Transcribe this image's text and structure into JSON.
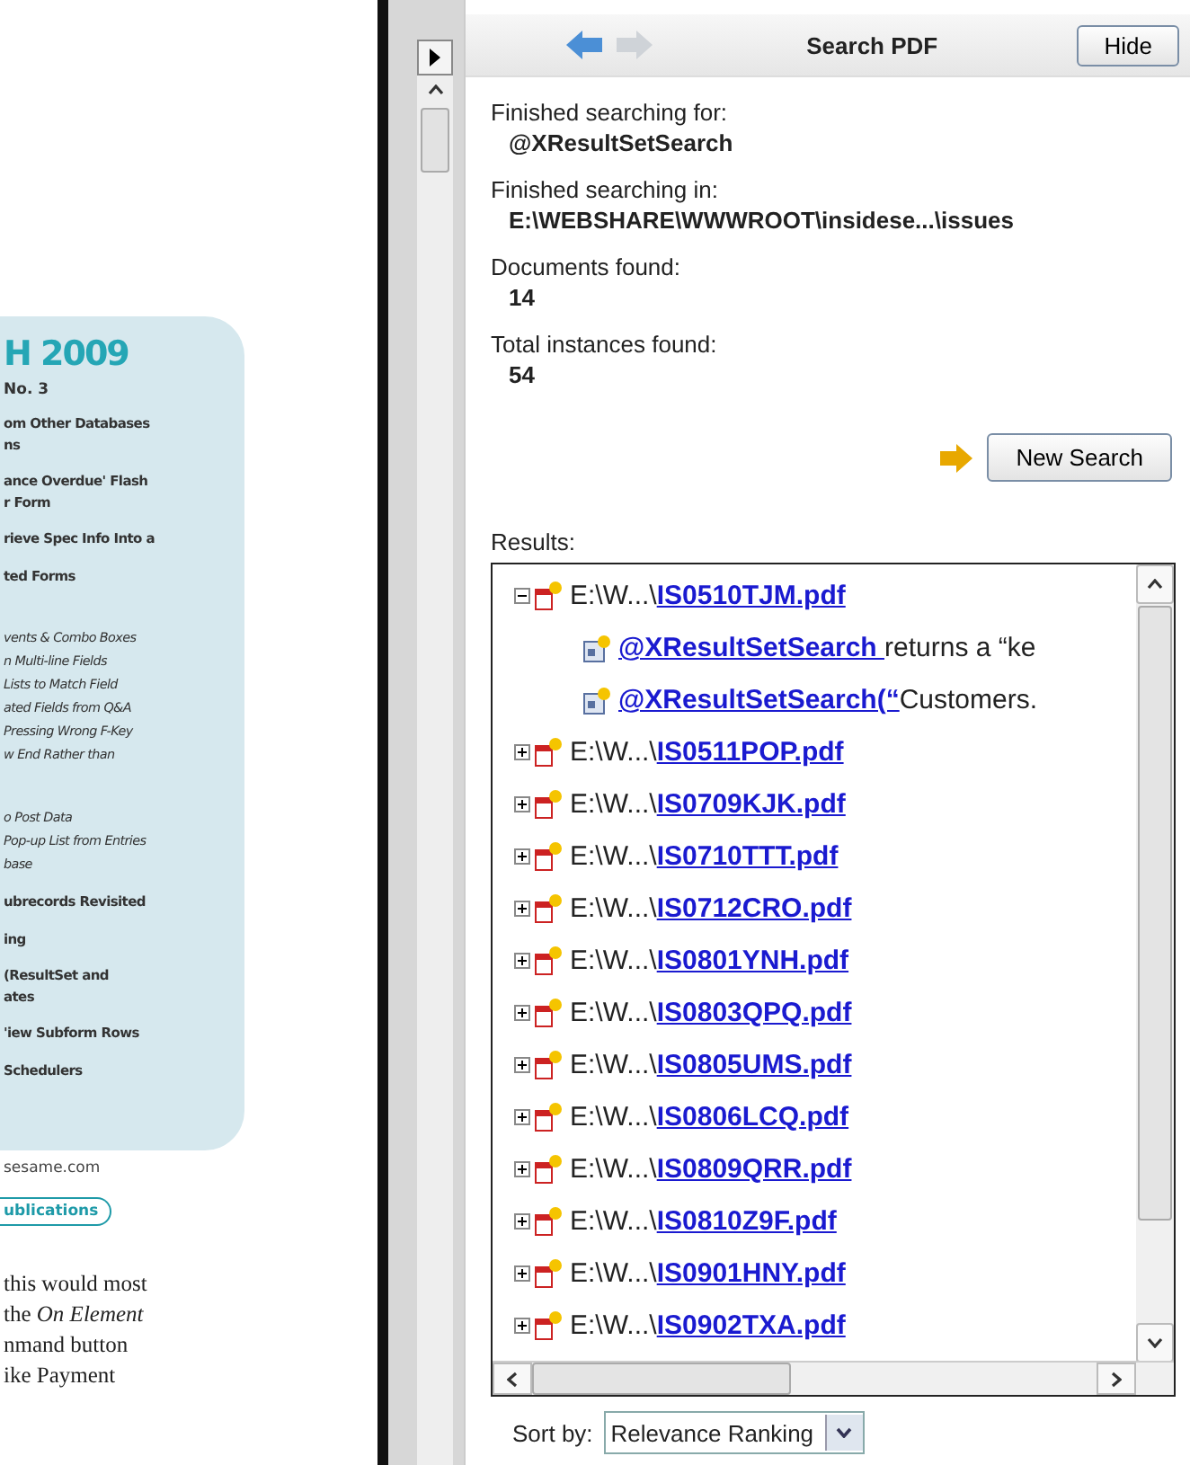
{
  "document": {
    "heading": "H 2009",
    "issue": "No. 3",
    "toc": [
      {
        "kind": "bold",
        "lines": [
          "om Other Databases",
          "ns"
        ]
      },
      {
        "kind": "bold",
        "lines": [
          "ance Overdue' Flash",
          "r Form"
        ]
      },
      {
        "kind": "bold",
        "lines": [
          "rieve Spec Info Into a"
        ]
      },
      {
        "kind": "bold",
        "lines": [
          "ted Forms"
        ]
      },
      {
        "kind": "italic",
        "lines": [
          "vents & Combo Boxes",
          "n Multi-line Fields",
          "Lists to Match Field",
          "ated Fields from Q&A",
          "Pressing Wrong F-Key",
          "w End Rather than"
        ]
      },
      {
        "kind": "italic",
        "lines": [
          "o Post Data",
          "Pop-up List from Entries",
          "base"
        ]
      },
      {
        "kind": "bold",
        "lines": [
          "ubrecords Revisited"
        ]
      },
      {
        "kind": "bold",
        "lines": [
          "ing"
        ]
      },
      {
        "kind": "bold",
        "lines": [
          "(ResultSet and",
          "ates"
        ]
      },
      {
        "kind": "bold",
        "lines": [
          "'iew Subform Rows"
        ]
      },
      {
        "kind": "bold",
        "lines": [
          "Schedulers"
        ]
      }
    ],
    "website": "sesame.com",
    "pill": "ublications",
    "body": [
      "this would most",
      "the *On Element*",
      "nmand button",
      "ike Payment"
    ]
  },
  "panel": {
    "title": "Search PDF",
    "back_disabled": false,
    "forward_disabled": true,
    "hide_button": "Hide",
    "fields": [
      {
        "label": "Finished searching for:",
        "value": "@XResultSetSearch"
      },
      {
        "label": "Finished searching in:",
        "value": "E:\\WEBSHARE\\WWWROOT\\insidese...\\issues"
      },
      {
        "label": "Documents found:",
        "value": "14"
      },
      {
        "label": "Total instances found:",
        "value": "54"
      }
    ],
    "new_search_button": "New Search",
    "results_label": "Results:",
    "results": [
      {
        "path": "E:\\W...\\",
        "file": "IS0510TJM.pdf",
        "expanded": true,
        "children": [
          {
            "link": "@XResultSetSearch ",
            "text": "returns a “ke"
          },
          {
            "link": "@XResultSetSearch(“",
            "text": "Customers."
          }
        ]
      },
      {
        "path": "E:\\W...\\",
        "file": "IS0511POP.pdf",
        "expanded": false
      },
      {
        "path": "E:\\W...\\",
        "file": "IS0709KJK.pdf",
        "expanded": false
      },
      {
        "path": "E:\\W...\\",
        "file": "IS0710TTT.pdf",
        "expanded": false
      },
      {
        "path": "E:\\W...\\",
        "file": "IS0712CRO.pdf",
        "expanded": false
      },
      {
        "path": "E:\\W...\\",
        "file": "IS0801YNH.pdf",
        "expanded": false
      },
      {
        "path": "E:\\W...\\",
        "file": "IS0803QPQ.pdf",
        "expanded": false
      },
      {
        "path": "E:\\W...\\",
        "file": "IS0805UMS.pdf",
        "expanded": false
      },
      {
        "path": "E:\\W...\\",
        "file": "IS0806LCQ.pdf",
        "expanded": false
      },
      {
        "path": "E:\\W...\\",
        "file": "IS0809QRR.pdf",
        "expanded": false
      },
      {
        "path": "E:\\W...\\",
        "file": "IS0810Z9F.pdf",
        "expanded": false
      },
      {
        "path": "E:\\W...\\",
        "file": "IS0901HNY.pdf",
        "expanded": false
      },
      {
        "path": "E:\\W...\\",
        "file": "IS0902TXA.pdf",
        "expanded": false
      }
    ],
    "sort_label": "Sort by:",
    "sort_value": "Relevance Ranking"
  }
}
